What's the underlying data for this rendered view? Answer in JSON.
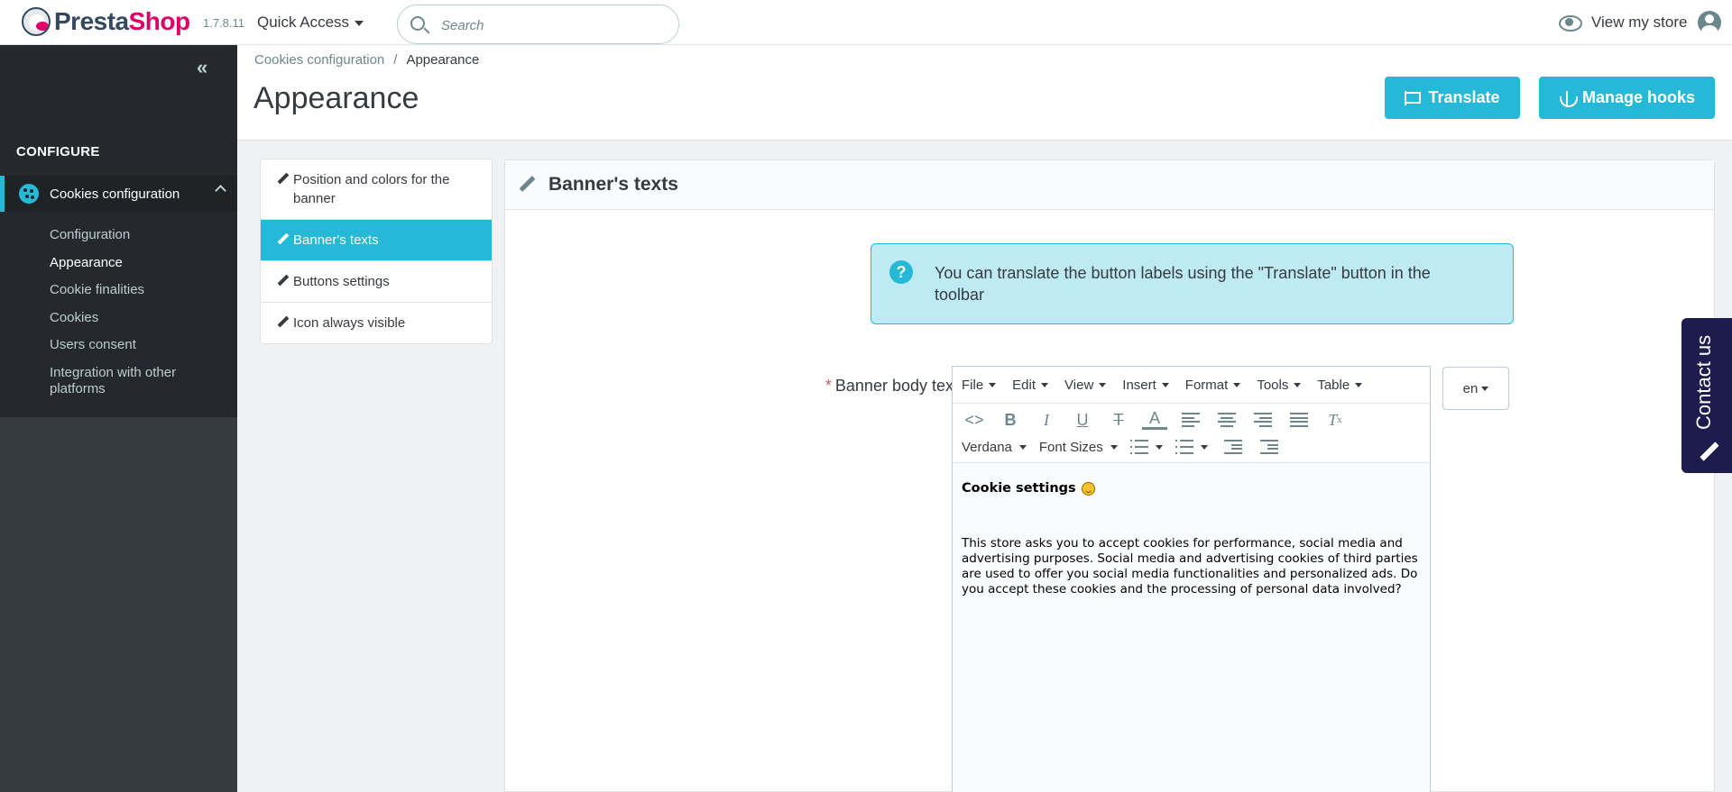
{
  "header": {
    "logo_part1": "Presta",
    "logo_part2": "Shop",
    "version": "1.7.8.11",
    "quick_access": "Quick Access",
    "search_placeholder": "Search",
    "view_store": "View my store"
  },
  "sidebar": {
    "section": "CONFIGURE",
    "active_item": "Cookies configuration",
    "submenu": [
      "Configuration",
      "Appearance",
      "Cookie finalities",
      "Cookies",
      "Users consent",
      "Integration with other platforms"
    ],
    "active_submenu": "Appearance"
  },
  "breadcrumb": {
    "parent": "Cookies configuration",
    "separator": "/",
    "current": "Appearance"
  },
  "page": {
    "title": "Appearance",
    "translate_label": "Translate",
    "manage_hooks_label": "Manage hooks"
  },
  "tabs": [
    {
      "label": "Position and colors for the banner",
      "active": false
    },
    {
      "label": "Banner's texts",
      "active": true
    },
    {
      "label": "Buttons settings",
      "active": false
    },
    {
      "label": "Icon always visible",
      "active": false
    }
  ],
  "panel": {
    "title": "Banner's texts",
    "alert_text": "You can translate the button labels using the \"Translate\" button in the toolbar",
    "field_required_mark": "*",
    "field_label": "Banner body text",
    "language": "en"
  },
  "editor": {
    "menus": [
      "File",
      "Edit",
      "View",
      "Insert",
      "Format",
      "Tools",
      "Table"
    ],
    "font_family": "Verdana",
    "font_sizes": "Font Sizes",
    "content_heading": "Cookie settings",
    "content_body": "This store asks you to accept cookies for performance, social media and advertising purposes. Social media and advertising cookies of third parties are used to offer you social media functionalities and personalized ads. Do you accept these cookies and the processing of personal data involved?"
  },
  "contact": {
    "label": "Contact us"
  },
  "colors": {
    "accent": "#25b9d7",
    "sidebar_dark": "#25282d",
    "brand_pink": "#df0067",
    "contact_bg": "#1e1c4e"
  }
}
